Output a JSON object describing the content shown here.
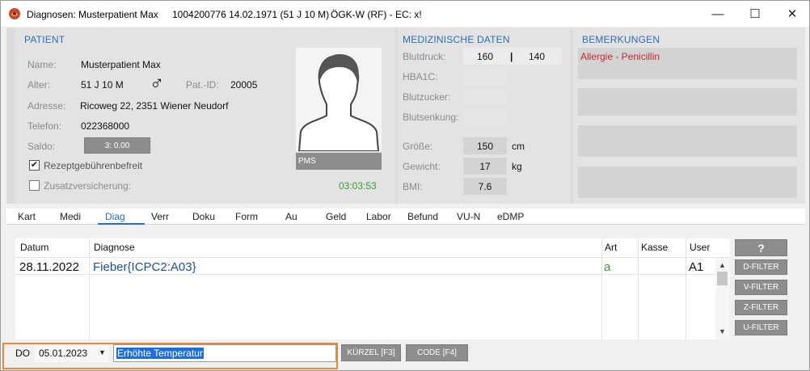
{
  "window": {
    "title": "Diagnosen: Musterpatient Max",
    "patient_id_info": "1004200776 14.02.1971 (51 J 10 M)",
    "insurance": "ÖGK-W (RF) - EC: x!",
    "minimize_glyph": "—",
    "maximize_glyph": "☐",
    "close_glyph": "✕"
  },
  "patient": {
    "section_title": "PATIENT",
    "name_label": "Name:",
    "name": "Musterpatient Max",
    "age_label": "Alter:",
    "age": "51 J 10 M",
    "gender_glyph": "♂",
    "patid_label": "Pat.-ID:",
    "patid": "20005",
    "address_label": "Adresse:",
    "address": "Ricoweg 22, 2351 Wiener Neudorf",
    "phone_label": "Telefon:",
    "phone": "022368000",
    "saldo_label": "Saldo:",
    "saldo": "3: 0.00",
    "rezept_label": "Rezeptgebührenbefreit",
    "zusatz_label": "Zusatzversicherung:",
    "photo_caption": "PMS",
    "timer": "03:03:53"
  },
  "medical": {
    "section_title": "MEDIZINISCHE DATEN",
    "blutdruck_label": "Blutdruck:",
    "bp_sys": "160",
    "bp_sep": "|",
    "bp_dia": "140",
    "hba1c_label": "HBA1C:",
    "blutzucker_label": "Blutzucker:",
    "blutsenkung_label": "Blutsenkung:",
    "groesse_label": "Größe:",
    "groesse": "150",
    "groesse_unit": "cm",
    "gewicht_label": "Gewicht:",
    "gewicht": "17",
    "gewicht_unit": "kg",
    "bmi_label": "BMI:",
    "bmi": "7.6"
  },
  "remarks": {
    "section_title": "BEMERKUNGEN",
    "note1": "Allergie - Penicillin"
  },
  "tabs": [
    "Kart",
    "Medi",
    "Diag",
    "Verr",
    "Doku",
    "Form",
    "Au",
    "Geld",
    "Labor",
    "Befund",
    "VU-N",
    "eDMP"
  ],
  "table": {
    "headers": {
      "datum": "Datum",
      "diagnose": "Diagnose",
      "art": "Art",
      "kasse": "Kasse",
      "user": "User"
    },
    "rows": [
      {
        "datum": "28.11.2022",
        "diagnose": "Fieber{ICPC2:A03}",
        "art": "a",
        "kasse": "",
        "user": "A1"
      }
    ]
  },
  "filters": {
    "help": "?",
    "d": "D-FILTER",
    "v": "V-FILTER",
    "z": "Z-FILTER",
    "u": "U-FILTER"
  },
  "entry": {
    "do_label": "DO",
    "date": "05.01.2023",
    "diagnosis_text": "Erhöhte Temperatur",
    "kuerzel_button": "KÜRZEL [F3]",
    "code_button": "CODE [F4]"
  },
  "colors": {
    "accent": "#2c6fb5",
    "remark_red": "#c0282d",
    "timer_green": "#3a9a3a",
    "highlight": "#e8893a"
  }
}
